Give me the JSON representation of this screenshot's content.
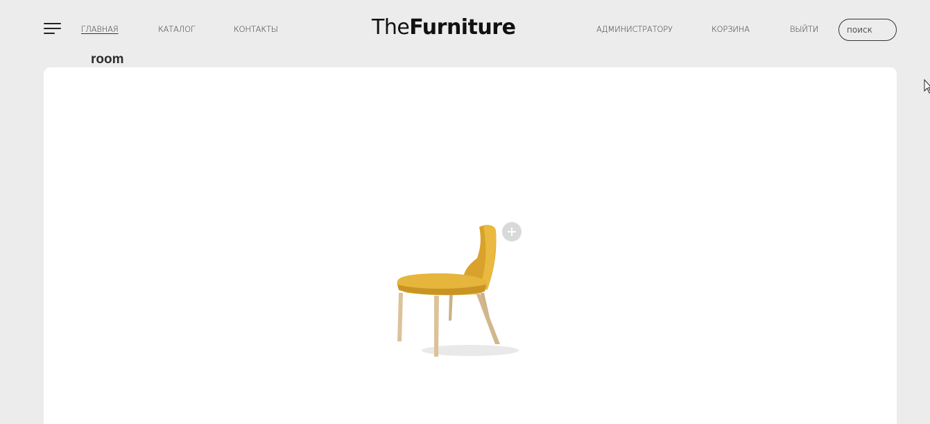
{
  "header": {
    "nav_left": [
      {
        "label": "ГЛАВНАЯ"
      },
      {
        "label": "КАТАЛОГ"
      },
      {
        "label": "КОНТАКТЫ"
      }
    ],
    "logo": {
      "light": "The",
      "bold": "Furniture"
    },
    "nav_right": [
      {
        "label": "АДМИНИСТРАТОРУ"
      },
      {
        "label": "КОРЗИНА"
      },
      {
        "label": "ВЫЙТИ"
      }
    ],
    "search": {
      "placeholder": "поиск",
      "value": ""
    }
  },
  "main": {
    "title": "room",
    "product": {
      "icon": "chair-image",
      "action_icon": "plus-icon"
    }
  },
  "colors": {
    "background": "#ececec",
    "card": "#ffffff",
    "chair_seat": "#e6b53c",
    "chair_legs": "#d9bf95"
  }
}
